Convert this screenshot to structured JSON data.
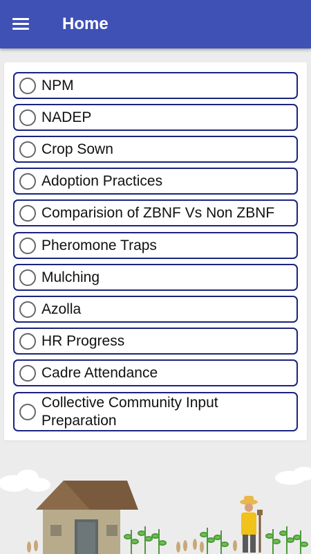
{
  "header": {
    "title": "Home",
    "menu_icon": "hamburger-menu-icon",
    "background_color": "#3f51b5"
  },
  "options": [
    {
      "label": "NPM"
    },
    {
      "label": "NADEP"
    },
    {
      "label": "Crop Sown"
    },
    {
      "label": "Adoption Practices"
    },
    {
      "label": "Comparision of ZBNF Vs Non ZBNF"
    },
    {
      "label": "Pheromone Traps"
    },
    {
      "label": "Mulching"
    },
    {
      "label": "Azolla"
    },
    {
      "label": "HR Progress"
    },
    {
      "label": "Cadre Attendance"
    },
    {
      "label": "Collective Community Input Preparation"
    }
  ],
  "colors": {
    "option_border": "#1a237e",
    "radio_border": "#666666"
  }
}
